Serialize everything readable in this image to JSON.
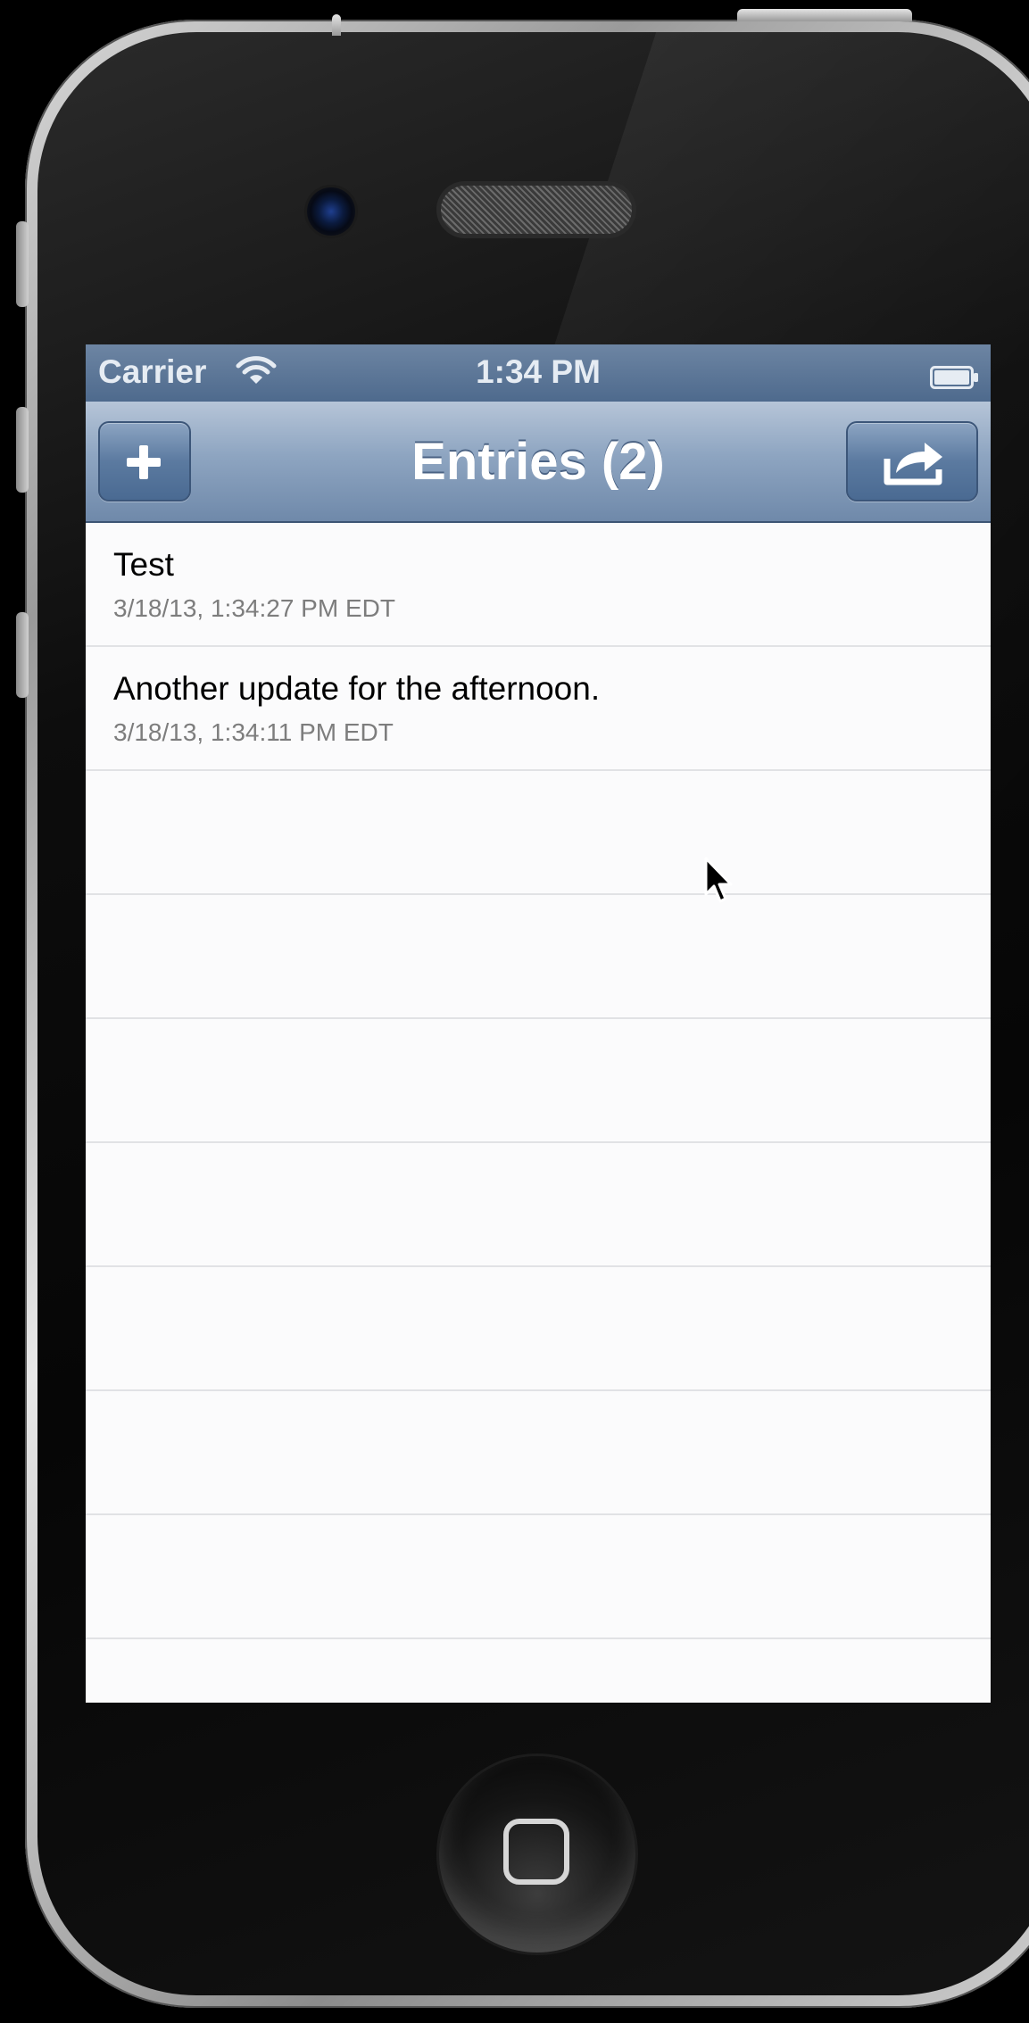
{
  "status_bar": {
    "carrier": "Carrier",
    "time": "1:34 PM",
    "wifi_icon": "wifi-icon",
    "battery_icon": "battery-icon"
  },
  "nav_bar": {
    "title": "Entries (2)",
    "left_button_icon": "plus-icon",
    "right_button_icon": "share-icon"
  },
  "entries": [
    {
      "title": "Test",
      "timestamp": "3/18/13, 1:34:27 PM EDT"
    },
    {
      "title": "Another update for the afternoon.",
      "timestamp": "3/18/13, 1:34:11 PM EDT"
    }
  ],
  "colors": {
    "nav_top": "#b6c5d8",
    "nav_bottom": "#6f89aa",
    "status_bar": "#5a7598",
    "separator": "#e1e2e5",
    "subtitle": "#7d7d7d"
  },
  "device": {
    "home_button_icon": "home-button-icon",
    "cursor_icon": "mouse-pointer-icon"
  }
}
